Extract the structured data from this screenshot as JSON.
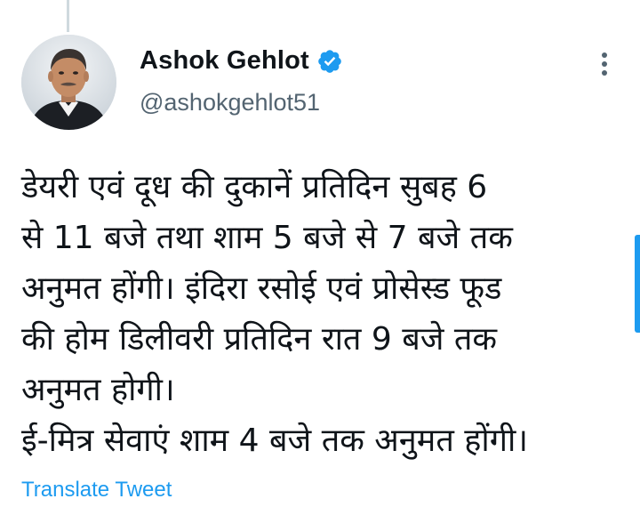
{
  "author": {
    "display_name": "Ashok Gehlot",
    "handle": "@ashokgehlot51",
    "verified": true,
    "avatar_icon": "profile-photo"
  },
  "tweet": {
    "text": "डेयरी एवं दूध की दुकानें प्रतिदिन सुबह 6\nसे 11 बजे तथा शाम 5 बजे से 7 बजे तक\nअनुमत होंगी। इंदिरा रसोई एवं प्रोसेस्ड फूड\nकी होम डिलीवरी प्रतिदिन रात 9 बजे तक\nअनुमत होगी।\nई-मित्र सेवाएं शाम 4 बजे तक अनुमत होंगी।"
  },
  "actions": {
    "translate_label": "Translate Tweet",
    "more_icon": "more-vertical-icon"
  },
  "colors": {
    "accent": "#1d9bf0",
    "text_primary": "#0f1419",
    "text_secondary": "#536471"
  }
}
